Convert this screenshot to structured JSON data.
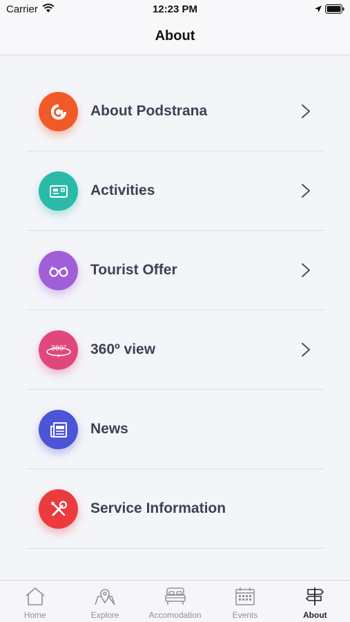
{
  "status": {
    "carrier": "Carrier",
    "time": "12:23 PM"
  },
  "nav": {
    "title": "About"
  },
  "menu": {
    "items": [
      {
        "label": "About Podstrana",
        "color": "#f05a28",
        "icon": "podstrana-logo-icon",
        "chevron": true
      },
      {
        "label": "Activities",
        "color": "#2bbaa8",
        "icon": "ticket-icon",
        "chevron": true
      },
      {
        "label": "Tourist Offer",
        "color": "#a05fd8",
        "icon": "glasses-icon",
        "chevron": true
      },
      {
        "label": "360º view",
        "color": "#e0487c",
        "icon": "360-view-icon",
        "chevron": true
      },
      {
        "label": "News",
        "color": "#4b55d6",
        "icon": "newspaper-icon",
        "chevron": false
      },
      {
        "label": "Service Information",
        "color": "#ec3b3f",
        "icon": "tools-icon",
        "chevron": false
      }
    ]
  },
  "tabs": [
    {
      "label": "Home",
      "icon": "home-icon",
      "active": false
    },
    {
      "label": "Explore",
      "icon": "map-pin-icon",
      "active": false
    },
    {
      "label": "Accomodation",
      "icon": "bed-icon",
      "active": false
    },
    {
      "label": "Events",
      "icon": "calendar-icon",
      "active": false
    },
    {
      "label": "About",
      "icon": "signpost-icon",
      "active": true
    }
  ]
}
